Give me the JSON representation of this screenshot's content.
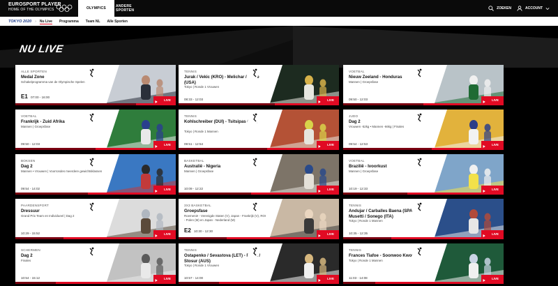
{
  "topbar": {
    "brand_line1": "EUROSPORT PLAYER",
    "brand_line2": "HOME OF THE OLYMPICS",
    "tabs": [
      {
        "label": "OLYMPICS",
        "active": true
      },
      {
        "label": "ANDERE SPORTEN",
        "active": false
      }
    ],
    "search_label": "ZOEKEN",
    "account_label": "ACCOUNT"
  },
  "subnav": {
    "tokyo_label": "TOKYO 2020",
    "items": [
      {
        "label": "Nu Live",
        "active": true
      },
      {
        "label": "Programma",
        "active": false
      },
      {
        "label": "Team NL",
        "active": false
      },
      {
        "label": "Alle Sporten",
        "active": false
      }
    ]
  },
  "section_title": "NU LIVE",
  "live_label": "LIVE",
  "colors": {
    "accent": "#e10a23",
    "bg": "#000000"
  },
  "cards": [
    {
      "category": "ALLE SPORTEN",
      "title": "Medal Zone",
      "subtitle": "Schakelprogramma van de Olympische Spelen",
      "channel": "E1",
      "time": "07:00 - 16:00",
      "progress": 0.75,
      "sport_icon": "torch-icon",
      "thumb": "studio"
    },
    {
      "category": "TENNIS",
      "title": "Jurak / Vekic (KRO) - Melichar / Riske (USA)",
      "subtitle": "Tokyo | Ronde 1 Vrouwen",
      "time": "08:33 - 12:03",
      "progress": 0.6,
      "sport_icon": "tennis-icon",
      "thumb": "tennis"
    },
    {
      "category": "VOETBAL",
      "title": "Nieuw Zeeland - Honduras",
      "subtitle": "Mannen | Groepsfase",
      "time": "09:50 - 12:03",
      "progress": 0.5,
      "sport_icon": "football-icon",
      "thumb": "football"
    },
    {
      "category": "VOETBAL",
      "title": "Frankrijk - Zuid Afrika",
      "subtitle": "Mannen | Groepsfase",
      "time": "09:50 - 12:03",
      "progress": 0.5,
      "sport_icon": "football-icon",
      "thumb": "football2"
    },
    {
      "category": "TENNIS",
      "title": "Kohlschreiber (DUI) - Tsitsipas (GRI)",
      "subtitle": "Tokyo | Ronde 1 Mannen",
      "time": "09:51 - 12:54",
      "progress": 0.55,
      "sport_icon": "tennis-icon",
      "thumb": "tennis2"
    },
    {
      "category": "JUDO",
      "title": "Dag 2",
      "subtitle": "Vrouwen -52kg • Mannen -66kg | Finales",
      "time": "09:54 - 12:53",
      "progress": 0.55,
      "sport_icon": "judo-icon",
      "thumb": "judo"
    },
    {
      "category": "BOKSEN",
      "title": "Dag 2",
      "subtitle": "Mannen • Vrouwen | Voorrondes meerdere gewichtsklassen",
      "time": "09:54 - 14:02",
      "progress": 0.45,
      "sport_icon": "boxing-icon",
      "thumb": "boxing"
    },
    {
      "category": "BASKETBAL",
      "title": "Australië - Nigeria",
      "subtitle": "Mannen | Groepsfase",
      "time": "10:09 - 12:22",
      "progress": 0.45,
      "sport_icon": "basketball-icon",
      "thumb": "basketball"
    },
    {
      "category": "VOETBAL",
      "title": "Brazilië - Ivoorkust",
      "subtitle": "Mannen | Groepsfase",
      "time": "10:19 - 12:33",
      "progress": 0.4,
      "sport_icon": "football-icon",
      "thumb": "football3"
    },
    {
      "category": "PAARDENSPORT",
      "title": "Dressuur",
      "subtitle": "Grand Prix Team en Individueel | Dag 2",
      "time": "10:29 - 15:52",
      "progress": 0.3,
      "sport_icon": "horse-icon",
      "thumb": "dressage"
    },
    {
      "category": "3X3 BASKETBAL",
      "title": "Groepsfase",
      "subtitle": "Roemenië - Verenigde Staten (V), Japan - Frankrijk (V), ROC - Polen (M) en Japan - Nederland (M)",
      "channel": "E2",
      "time": "10:30 - 12:30",
      "progress": 0.3,
      "sport_icon": "basketball-icon",
      "thumb": "3x3"
    },
    {
      "category": "TENNIS",
      "title": "Andujar / Carballes Baena (SPA) - Musetti / Sonego (ITA)",
      "subtitle": "Tokyo | Ronde 1 Mannen",
      "time": "10:35 - 12:35",
      "progress": 0.3,
      "sport_icon": "tennis-icon",
      "thumb": "tennis3"
    },
    {
      "category": "SCHERMEN",
      "title": "Dag 2",
      "subtitle": "Finales",
      "time": "10:54 - 15:12",
      "progress": 0.25,
      "sport_icon": "fencing-icon",
      "thumb": "fencing"
    },
    {
      "category": "TENNIS",
      "title": "Ostapenko / Sevastova (LET) - Perez / Stosur (AUS)",
      "subtitle": "Tokyo | Ronde 1 Vrouwen",
      "time": "10:57 - 14:00",
      "progress": 0.25,
      "sport_icon": "tennis-icon",
      "thumb": "tennis4"
    },
    {
      "category": "TENNIS",
      "title": "Frances Tiafoe - Soonwoo Kwon",
      "subtitle": "Tokyo | Ronde 1 Mannen",
      "time": "11:03 - 14:08",
      "progress": 0.2,
      "sport_icon": "tennis-icon",
      "thumb": "tennis5"
    }
  ]
}
